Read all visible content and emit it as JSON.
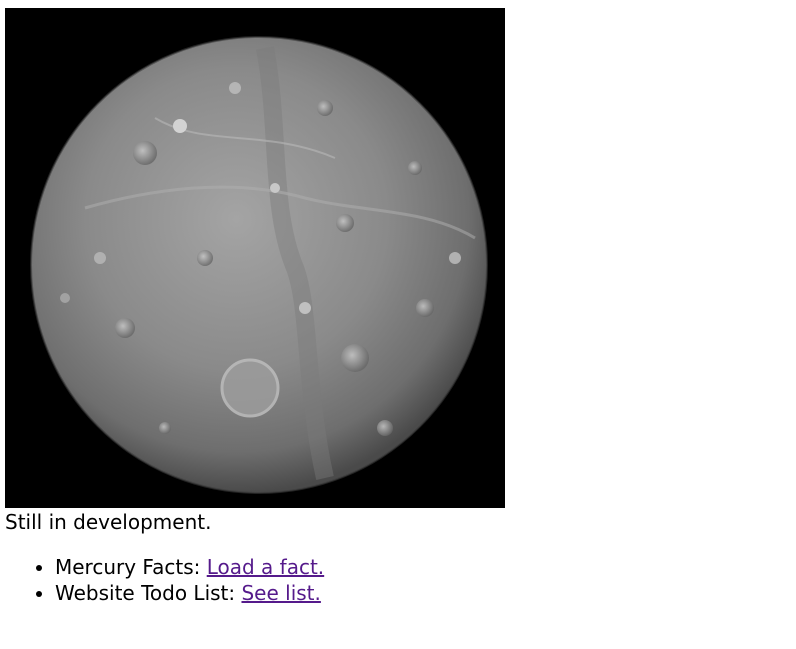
{
  "colors": {
    "link_visited": "#551a8b",
    "text": "#000000",
    "image_background": "#000000"
  },
  "image": {
    "icon": "mercury-planet-photo"
  },
  "status": {
    "text": "Still in development."
  },
  "links": [
    {
      "label": "Mercury Facts: ",
      "link_text": "Load a fact."
    },
    {
      "label": "Website Todo List: ",
      "link_text": "See list."
    }
  ]
}
